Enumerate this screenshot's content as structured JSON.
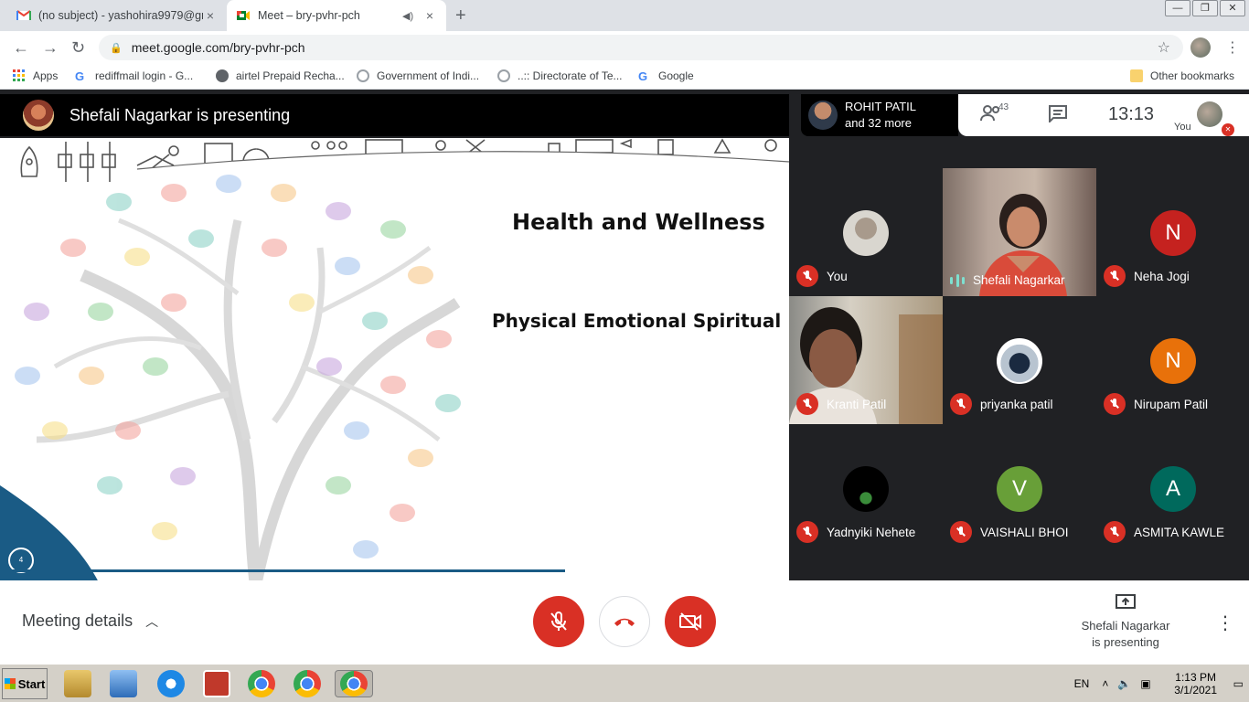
{
  "browser": {
    "tabs": [
      {
        "title": "(no subject) - yashohira9979@gm",
        "close": "×"
      },
      {
        "title": "Meet – bry-pvhr-pch",
        "close": "×"
      }
    ],
    "new_tab": "+",
    "url": "meet.google.com/bry-pvhr-pch",
    "bookmarks": [
      {
        "label": "Apps",
        "icon": "apps-grid-icon"
      },
      {
        "label": "rediffmail login - G...",
        "icon": "google-icon"
      },
      {
        "label": "airtel Prepaid Recha...",
        "icon": "globe-icon"
      },
      {
        "label": "Government of Indi...",
        "icon": "emblem-icon"
      },
      {
        "label": "..:: Directorate of Te...",
        "icon": "emblem-icon"
      },
      {
        "label": "Google",
        "icon": "google-icon"
      }
    ],
    "other_bookmarks": "Other bookmarks"
  },
  "meet": {
    "presenter_banner": "Shefali Nagarkar is presenting",
    "participants_pill": {
      "name": "ROHIT PATIL",
      "more": "and 32 more"
    },
    "people_count": "43",
    "time": "13:13",
    "you_label": "You",
    "slide": {
      "title": "Health and Wellness",
      "subtitle": "Physical Emotional Spiritual",
      "page_number": "4",
      "progress": 1.0
    },
    "tiles": [
      {
        "name": "You",
        "type": "photo-small",
        "muted": true
      },
      {
        "name": "Shefali Nagarkar",
        "type": "video",
        "muted": false
      },
      {
        "name": "Neha Jogi",
        "type": "letter",
        "letter": "N",
        "color": "#c5221f",
        "muted": true
      },
      {
        "name": "Kranti Patil",
        "type": "video",
        "muted": true
      },
      {
        "name": "priyanka patil",
        "type": "photo-small",
        "muted": true
      },
      {
        "name": "Nirupam Patil",
        "type": "letter",
        "letter": "N",
        "color": "#e8710a",
        "muted": true
      },
      {
        "name": "Yadnyiki Nehete",
        "type": "photo-small",
        "muted": true
      },
      {
        "name": "VAISHALI BHOI",
        "type": "letter",
        "letter": "V",
        "color": "#689f38",
        "muted": true
      },
      {
        "name": "ASMITA KAWLE",
        "type": "letter",
        "letter": "A",
        "color": "#00695c",
        "muted": true
      }
    ],
    "controls": {
      "meeting_details": "Meeting details",
      "presenting_line1": "Shefali Nagarkar",
      "presenting_line2": "is presenting"
    }
  },
  "taskbar": {
    "start": "Start",
    "lang": "EN",
    "time": "1:13 PM",
    "date": "3/1/2021"
  }
}
